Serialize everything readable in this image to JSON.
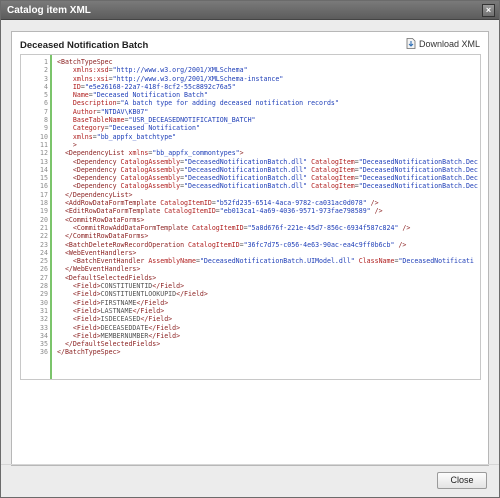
{
  "window": {
    "title": "Catalog item XML",
    "close_glyph": "×"
  },
  "panel": {
    "title": "Deceased Notification Batch",
    "download_label": "Download XML"
  },
  "editor": {
    "lines": [
      [
        "1",
        [
          [
            "t",
            "<BatchTypeSpec"
          ]
        ]
      ],
      [
        "2",
        [
          [
            "a",
            "    xmlns:xsd"
          ],
          [
            "p",
            "="
          ],
          [
            "v",
            "\"http://www.w3.org/2001/XMLSchema\""
          ]
        ]
      ],
      [
        "3",
        [
          [
            "a",
            "    xmlns:xsi"
          ],
          [
            "p",
            "="
          ],
          [
            "v",
            "\"http://www.w3.org/2001/XMLSchema-instance\""
          ]
        ]
      ],
      [
        "4",
        [
          [
            "a",
            "    ID"
          ],
          [
            "p",
            "="
          ],
          [
            "v",
            "\"e5e26168-22a7-418f-8cf2-55c8892c76a5\""
          ]
        ]
      ],
      [
        "5",
        [
          [
            "a",
            "    Name"
          ],
          [
            "p",
            "="
          ],
          [
            "v",
            "\"Deceased Notification Batch\""
          ]
        ]
      ],
      [
        "6",
        [
          [
            "a",
            "    Description"
          ],
          [
            "p",
            "="
          ],
          [
            "v",
            "\"A batch type for adding deceased notification records\""
          ]
        ]
      ],
      [
        "7",
        [
          [
            "a",
            "    Author"
          ],
          [
            "p",
            "="
          ],
          [
            "v",
            "\"NTDAV\\KB07\""
          ]
        ]
      ],
      [
        "8",
        [
          [
            "a",
            "    BaseTableName"
          ],
          [
            "p",
            "="
          ],
          [
            "v",
            "\"USR_DECEASEDNOTIFICATION_BATCH\""
          ]
        ]
      ],
      [
        "9",
        [
          [
            "a",
            "    Category"
          ],
          [
            "p",
            "="
          ],
          [
            "v",
            "\"Deceased Notification\""
          ]
        ]
      ],
      [
        "10",
        [
          [
            "a",
            "    xmlns"
          ],
          [
            "p",
            "="
          ],
          [
            "v",
            "\"bb_appfx_batchtype\""
          ]
        ]
      ],
      [
        "11",
        [
          [
            "t",
            "    >"
          ]
        ]
      ],
      [
        "12",
        [
          [
            "t",
            "  <DependencyList "
          ],
          [
            "a",
            "xmlns"
          ],
          [
            "p",
            "="
          ],
          [
            "v",
            "\"bb_appfx_commontypes\""
          ],
          [
            "t",
            ">"
          ]
        ]
      ],
      [
        "13",
        [
          [
            "t",
            "    <Dependency "
          ],
          [
            "a",
            "CatalogAssembly"
          ],
          [
            "p",
            "="
          ],
          [
            "v",
            "\"DeceasedNotificationBatch.dll\" "
          ],
          [
            "a",
            "CatalogItem"
          ],
          [
            "p",
            "="
          ],
          [
            "v",
            "\"DeceasedNotificationBatch.Dec"
          ]
        ]
      ],
      [
        "14",
        [
          [
            "t",
            "    <Dependency "
          ],
          [
            "a",
            "CatalogAssembly"
          ],
          [
            "p",
            "="
          ],
          [
            "v",
            "\"DeceasedNotificationBatch.dll\" "
          ],
          [
            "a",
            "CatalogItem"
          ],
          [
            "p",
            "="
          ],
          [
            "v",
            "\"DeceasedNotificationBatch.Dec"
          ]
        ]
      ],
      [
        "15",
        [
          [
            "t",
            "    <Dependency "
          ],
          [
            "a",
            "CatalogAssembly"
          ],
          [
            "p",
            "="
          ],
          [
            "v",
            "\"DeceasedNotificationBatch.dll\" "
          ],
          [
            "a",
            "CatalogItem"
          ],
          [
            "p",
            "="
          ],
          [
            "v",
            "\"DeceasedNotificationBatch.Dec"
          ]
        ]
      ],
      [
        "16",
        [
          [
            "t",
            "    <Dependency "
          ],
          [
            "a",
            "CatalogAssembly"
          ],
          [
            "p",
            "="
          ],
          [
            "v",
            "\"DeceasedNotificationBatch.dll\" "
          ],
          [
            "a",
            "CatalogItem"
          ],
          [
            "p",
            "="
          ],
          [
            "v",
            "\"DeceasedNotificationBatch.Dec"
          ]
        ]
      ],
      [
        "17",
        [
          [
            "t",
            "  </DependencyList>"
          ]
        ]
      ],
      [
        "18",
        [
          [
            "t",
            "  <AddRowDataFormTemplate "
          ],
          [
            "a",
            "CatalogItemID"
          ],
          [
            "p",
            "="
          ],
          [
            "v",
            "\"b52fd235-6514-4aca-9782-ca031ac0d078\""
          ],
          [
            "t",
            " />"
          ]
        ]
      ],
      [
        "19",
        [
          [
            "t",
            "  <EditRowDataFormTemplate "
          ],
          [
            "a",
            "CatalogItemID"
          ],
          [
            "p",
            "="
          ],
          [
            "v",
            "\"eb013ca1-4a69-4036-9571-973fae798589\""
          ],
          [
            "t",
            " />"
          ]
        ]
      ],
      [
        "20",
        [
          [
            "t",
            "  <CommitRowDataForms>"
          ]
        ]
      ],
      [
        "21",
        [
          [
            "t",
            "    <CommitRowAddDataFormTemplate "
          ],
          [
            "a",
            "CatalogItemID"
          ],
          [
            "p",
            "="
          ],
          [
            "v",
            "\"5a8d676f-221e-45d7-856c-6934f587c824\""
          ],
          [
            "t",
            " />"
          ]
        ]
      ],
      [
        "22",
        [
          [
            "t",
            "  </CommitRowDataForms>"
          ]
        ]
      ],
      [
        "23",
        [
          [
            "t",
            "  <BatchDeleteRowRecordOperation "
          ],
          [
            "a",
            "CatalogItemID"
          ],
          [
            "p",
            "="
          ],
          [
            "v",
            "\"36fc7d75-c056-4e63-90ac-ea4c9ff0b6cb\""
          ],
          [
            "t",
            " />"
          ]
        ]
      ],
      [
        "24",
        [
          [
            "t",
            "  <WebEventHandlers>"
          ]
        ]
      ],
      [
        "25",
        [
          [
            "t",
            "    <BatchEventHandler "
          ],
          [
            "a",
            "AssemblyName"
          ],
          [
            "p",
            "="
          ],
          [
            "v",
            "\"DeceasedNotificationBatch.UIModel.dll\" "
          ],
          [
            "a",
            "ClassName"
          ],
          [
            "p",
            "="
          ],
          [
            "v",
            "\"DeceasedNotificati"
          ]
        ]
      ],
      [
        "26",
        [
          [
            "t",
            "  </WebEventHandlers>"
          ]
        ]
      ],
      [
        "27",
        [
          [
            "t",
            "  <DefaultSelectedFields>"
          ]
        ]
      ],
      [
        "28",
        [
          [
            "t",
            "    <Field>"
          ],
          [
            "p",
            "CONSTITUENTID"
          ],
          [
            "t",
            "</Field>"
          ]
        ]
      ],
      [
        "29",
        [
          [
            "t",
            "    <Field>"
          ],
          [
            "p",
            "CONSTITUENTLOOKUPID"
          ],
          [
            "t",
            "</Field>"
          ]
        ]
      ],
      [
        "30",
        [
          [
            "t",
            "    <Field>"
          ],
          [
            "p",
            "FIRSTNAME"
          ],
          [
            "t",
            "</Field>"
          ]
        ]
      ],
      [
        "31",
        [
          [
            "t",
            "    <Field>"
          ],
          [
            "p",
            "LASTNAME"
          ],
          [
            "t",
            "</Field>"
          ]
        ]
      ],
      [
        "32",
        [
          [
            "t",
            "    <Field>"
          ],
          [
            "p",
            "ISDECEASED"
          ],
          [
            "t",
            "</Field>"
          ]
        ]
      ],
      [
        "33",
        [
          [
            "t",
            "    <Field>"
          ],
          [
            "p",
            "DECEASEDDATE"
          ],
          [
            "t",
            "</Field>"
          ]
        ]
      ],
      [
        "34",
        [
          [
            "t",
            "    <Field>"
          ],
          [
            "p",
            "MEMBERNUMBER"
          ],
          [
            "t",
            "</Field>"
          ]
        ]
      ],
      [
        "35",
        [
          [
            "t",
            "  </DefaultSelectedFields>"
          ]
        ]
      ],
      [
        "36",
        [
          [
            "t",
            "</BatchTypeSpec>"
          ]
        ]
      ]
    ]
  },
  "footer": {
    "close_label": "Close"
  },
  "colors": {
    "gutter_accent": "#7bc46b",
    "tag": "#8a1f1f",
    "attribute": "#b02020",
    "value": "#1f3fb8"
  },
  "icons": {
    "download": "download-icon",
    "close": "close-icon"
  }
}
